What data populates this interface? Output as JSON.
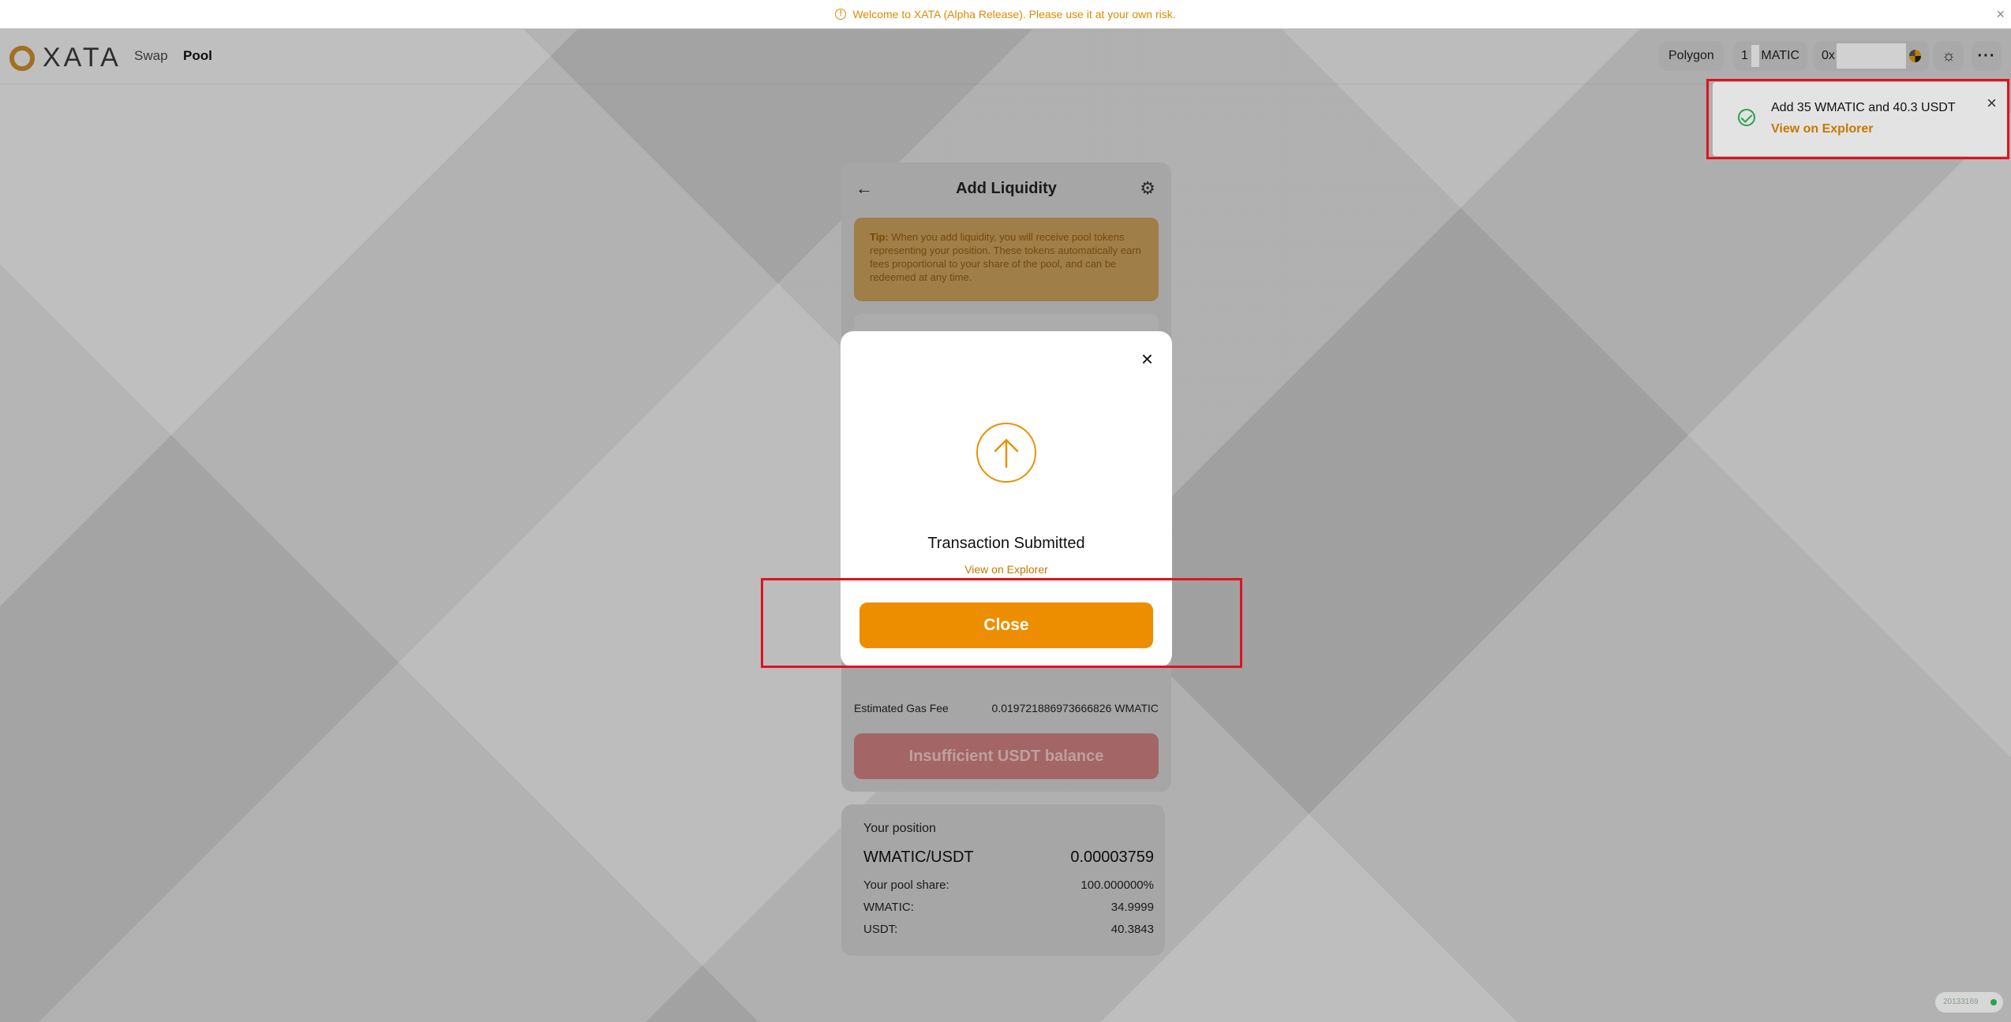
{
  "banner": {
    "text": "Welcome to XATA (Alpha Release). Please use it at your own risk.",
    "close": "×"
  },
  "header": {
    "logo": "XATA",
    "nav": {
      "swap": "Swap",
      "pool": "Pool"
    },
    "network": "Polygon",
    "balance_prefix": "1",
    "balance_unit": "MATIC",
    "address_prefix": "0x",
    "more": "···"
  },
  "toast": {
    "title": "Add 35 WMATIC and 40.3 USDT",
    "link": "View on Explorer",
    "close": "×"
  },
  "card": {
    "title": "Add Liquidity",
    "tip_label": "Tip:",
    "tip_text": " When you add liquidity, you will receive pool tokens representing your position. These tokens automatically earn fees proportional to your share of the pool, and can be redeemed at any time.",
    "gas_label": "Estimated Gas Fee",
    "gas_value": "0.019721886973666826 WMATIC",
    "action_button": "Insufficient USDT balance"
  },
  "position": {
    "heading": "Your position",
    "pair": "WMATIC/USDT",
    "amount": "0.00003759",
    "rows": [
      {
        "label": "Your pool share:",
        "value": "100.000000%"
      },
      {
        "label": "WMATIC:",
        "value": "34.9999"
      },
      {
        "label": "USDT:",
        "value": "40.3843"
      }
    ]
  },
  "modal": {
    "title": "Transaction Submitted",
    "link": "View on Explorer",
    "close_button": "Close",
    "close_icon": "×"
  },
  "version": "20133169",
  "colors": {
    "accent": "#ed8e00",
    "highlight": "#e0121f",
    "success": "#2aa14a"
  }
}
